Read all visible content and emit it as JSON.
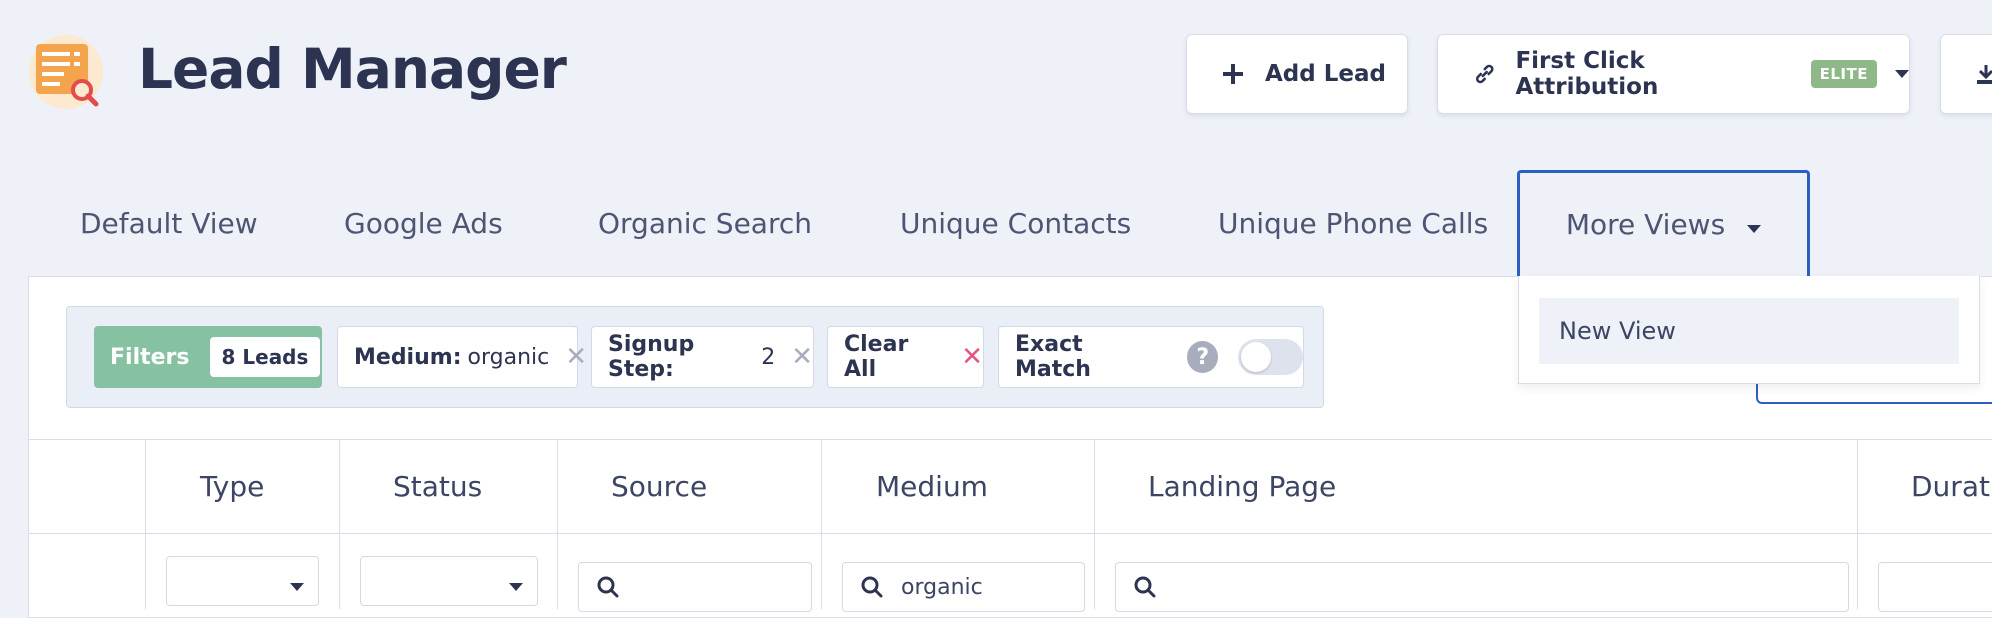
{
  "header": {
    "title": "Lead Manager",
    "add_lead_label": "Add Lead",
    "attribution_label": "First Click Attribution",
    "elite_badge": "ELITE"
  },
  "tabs": [
    {
      "label": "Default View"
    },
    {
      "label": "Google Ads"
    },
    {
      "label": "Organic Search"
    },
    {
      "label": "Unique Contacts"
    },
    {
      "label": "Unique Phone Calls"
    },
    {
      "label": "More Views"
    }
  ],
  "more_views_menu": {
    "items": [
      "New View"
    ]
  },
  "filters": {
    "label": "Filters",
    "count": "8 Leads",
    "chips": [
      {
        "key": "Medium:",
        "value": "organic"
      },
      {
        "key": "Signup Step:",
        "value": "2"
      }
    ],
    "clear_all_label": "Clear All",
    "exact_match_label": "Exact Match",
    "exact_match_on": false,
    "help_glyph": "?"
  },
  "table": {
    "columns": [
      "Type",
      "Status",
      "Source",
      "Medium",
      "Landing Page",
      "Durati"
    ],
    "filter_inputs": {
      "medium_value": "organic"
    }
  },
  "colors": {
    "accent": "#2d5fc0",
    "filters_chip": "#86c2a1",
    "elite_badge": "#8fb889",
    "clear_x": "#e2557c"
  },
  "icons": [
    "lead-manager-logo-icon",
    "plus-icon",
    "link-icon",
    "chevron-down-icon",
    "download-icon",
    "close-icon",
    "help-icon",
    "search-icon"
  ]
}
